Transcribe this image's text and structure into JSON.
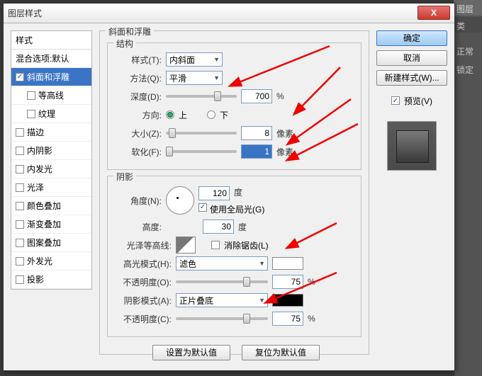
{
  "bg": {
    "tab": "图层",
    "sub": "类",
    "r1": "正常",
    "r2": "锁定"
  },
  "dialog": {
    "title": "图层样式",
    "close": "X"
  },
  "styles": {
    "header": "样式",
    "blend": "混合选项:默认",
    "bevel": "斜面和浮雕",
    "contour": "等高线",
    "texture": "纹理",
    "stroke": "描边",
    "innerShadow": "内阴影",
    "innerGlow": "内发光",
    "satin": "光泽",
    "colorOverlay": "颜色叠加",
    "gradientOverlay": "渐变叠加",
    "patternOverlay": "图案叠加",
    "outerGlow": "外发光",
    "dropShadow": "投影"
  },
  "panel": {
    "title": "斜面和浮雕",
    "structure": "结构",
    "styleLbl": "样式(T):",
    "styleVal": "内斜面",
    "techLbl": "方法(Q):",
    "techVal": "平滑",
    "depthLbl": "深度(D):",
    "depthVal": "700",
    "pct": "%",
    "dirLbl": "方向:",
    "dirUp": "上",
    "dirDown": "下",
    "sizeLbl": "大小(Z):",
    "sizeVal": "8",
    "px": "像素",
    "softenLbl": "软化(F):",
    "softenVal": "1",
    "shading": "阴影",
    "angleLbl": "角度(N):",
    "angleVal": "120",
    "degree": "度",
    "globalLight": "使用全局光(G)",
    "altLbl": "高度:",
    "altVal": "30",
    "glossLbl": "光泽等高线:",
    "antiAlias": "消除锯齿(L)",
    "hlModeLbl": "高光模式(H):",
    "hlModeVal": "滤色",
    "hlOpLbl": "不透明度(O):",
    "hlOpVal": "75",
    "shModeLbl": "阴影模式(A):",
    "shModeVal": "正片叠底",
    "shOpLbl": "不透明度(C):",
    "shOpVal": "75",
    "hlColor": "#ffffff",
    "shColor": "#000000",
    "setDefault": "设置为默认值",
    "resetDefault": "复位为默认值"
  },
  "right": {
    "ok": "确定",
    "cancel": "取消",
    "newStyle": "新建样式(W)...",
    "preview": "预览(V)"
  }
}
